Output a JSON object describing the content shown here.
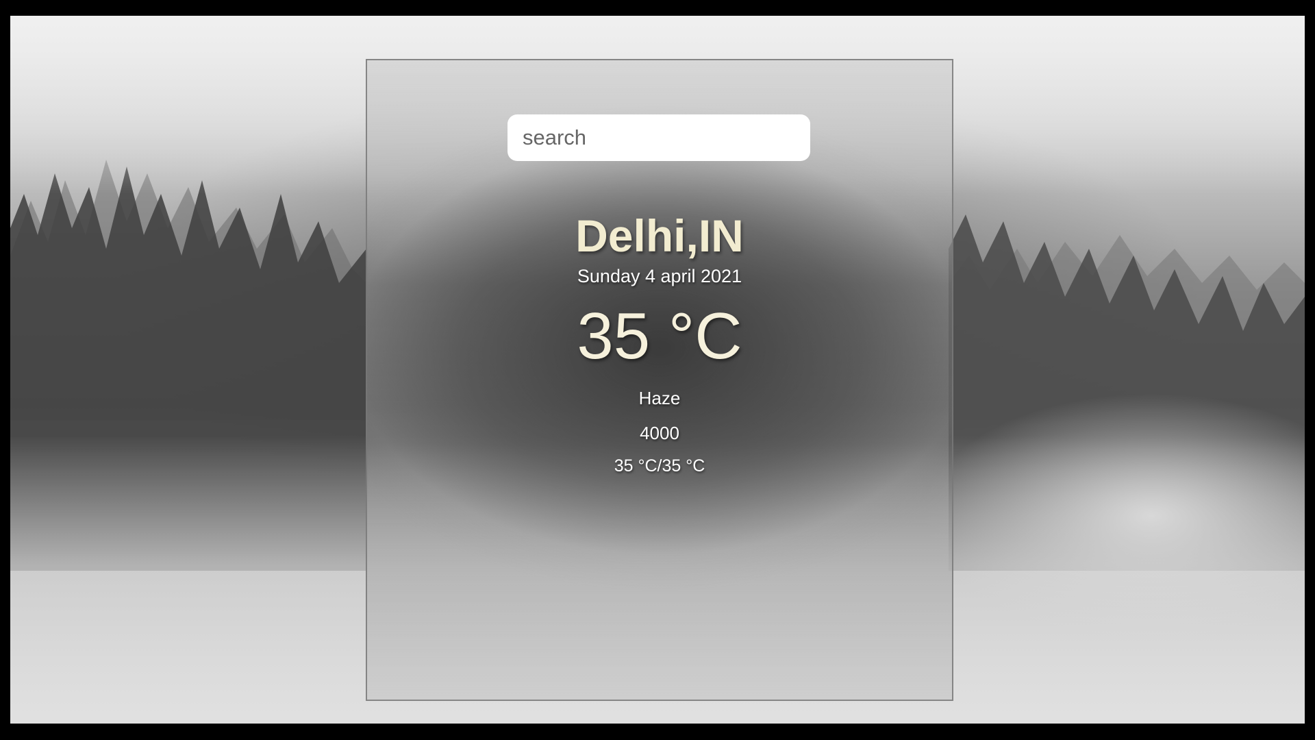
{
  "search": {
    "placeholder": "search",
    "value": ""
  },
  "weather": {
    "location": "Delhi,IN",
    "date": "Sunday 4 april 2021",
    "temperature": "35 °C",
    "condition": "Haze",
    "visibility": "4000",
    "hi_low": "35 °C/35 °C"
  },
  "colors": {
    "location_text": "#f2ecd0",
    "temperature_text": "#f6f1dc",
    "detail_text": "#ffffff",
    "search_background": "#ffffff"
  }
}
